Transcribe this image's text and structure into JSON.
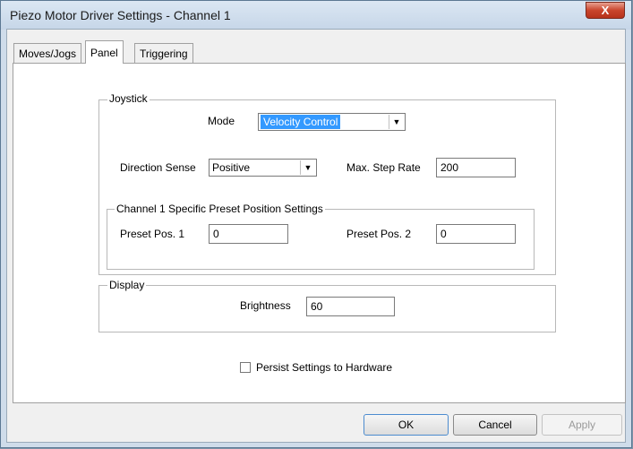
{
  "window": {
    "title": "Piezo Motor Driver Settings - Channel 1",
    "close_label": "X"
  },
  "tabs": [
    {
      "label": "Moves/Jogs",
      "active": false
    },
    {
      "label": "Panel",
      "active": true
    },
    {
      "label": "Triggering",
      "active": false
    }
  ],
  "joystick": {
    "legend": "Joystick",
    "mode_label": "Mode",
    "mode_value": "Velocity Control",
    "direction_label": "Direction Sense",
    "direction_value": "Positive",
    "max_step_label": "Max. Step Rate",
    "max_step_value": "200",
    "preset_group": {
      "legend": "Channel 1 Specific Preset Position Settings",
      "pos1_label": "Preset Pos. 1",
      "pos1_value": "0",
      "pos2_label": "Preset Pos. 2",
      "pos2_value": "0"
    }
  },
  "display": {
    "legend": "Display",
    "brightness_label": "Brightness",
    "brightness_value": "60"
  },
  "persist": {
    "label": "Persist Settings to Hardware",
    "checked": false
  },
  "buttons": {
    "ok": "OK",
    "cancel": "Cancel",
    "apply": "Apply"
  },
  "icons": {
    "dropdown": "chevron-down-icon",
    "close": "close-icon"
  },
  "colors": {
    "selection": "#3399ff",
    "close_button": "#c9452c",
    "frame": "#cfdcea"
  }
}
